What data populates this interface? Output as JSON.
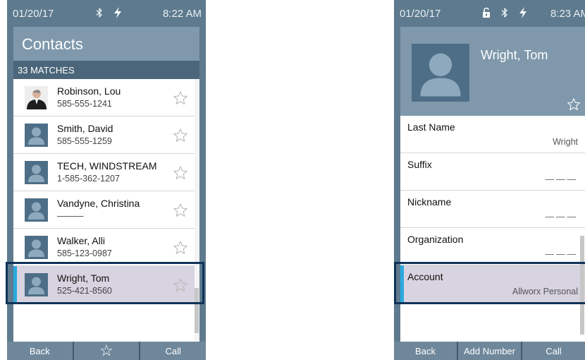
{
  "left": {
    "status": {
      "date": "01/20/17",
      "time": "8:22 AM"
    },
    "title": "Contacts",
    "matches": "33 MATCHES",
    "contacts": [
      {
        "name": "Robinson, Lou",
        "phone": "585-555-1241",
        "avatar": "photo"
      },
      {
        "name": "Smith, David",
        "phone": "585-555-1259",
        "avatar": "person-icon"
      },
      {
        "name": "TECH, WINDSTREAM",
        "phone": "1-585-362-1207",
        "avatar": "person-icon"
      },
      {
        "name": "Vandyne, Christina",
        "phone": "———",
        "avatar": "person-icon"
      },
      {
        "name": "Walker, Alli",
        "phone": "585-123-0987",
        "avatar": "person-icon"
      },
      {
        "name": "Wright, Tom",
        "phone": "525-421-8560",
        "avatar": "person-icon",
        "selected": true
      }
    ],
    "buttons": {
      "back": "Back",
      "favorite": "☆",
      "call": "Call"
    }
  },
  "right": {
    "status": {
      "date": "01/20/17",
      "time": "8:23 AM"
    },
    "name": "Wright, Tom",
    "fields": [
      {
        "label": "Last Name",
        "value": "Wright"
      },
      {
        "label": "Suffix",
        "value": "———"
      },
      {
        "label": "Nickname",
        "value": "———"
      },
      {
        "label": "Organization",
        "value": "———"
      },
      {
        "label": "Account",
        "value": "Allworx Personal",
        "selected": true
      }
    ],
    "buttons": {
      "back": "Back",
      "add_number": "Add Number",
      "call": "Call"
    }
  },
  "colors": {
    "frame": "#5e7a8e",
    "header": "#7f98ab",
    "matches_bar": "#4b667a",
    "avatar": "#4d6e86",
    "selected_row": "#d7d3e0",
    "selection_accent": "#29a9e0",
    "highlight_outline": "#0f3358"
  }
}
